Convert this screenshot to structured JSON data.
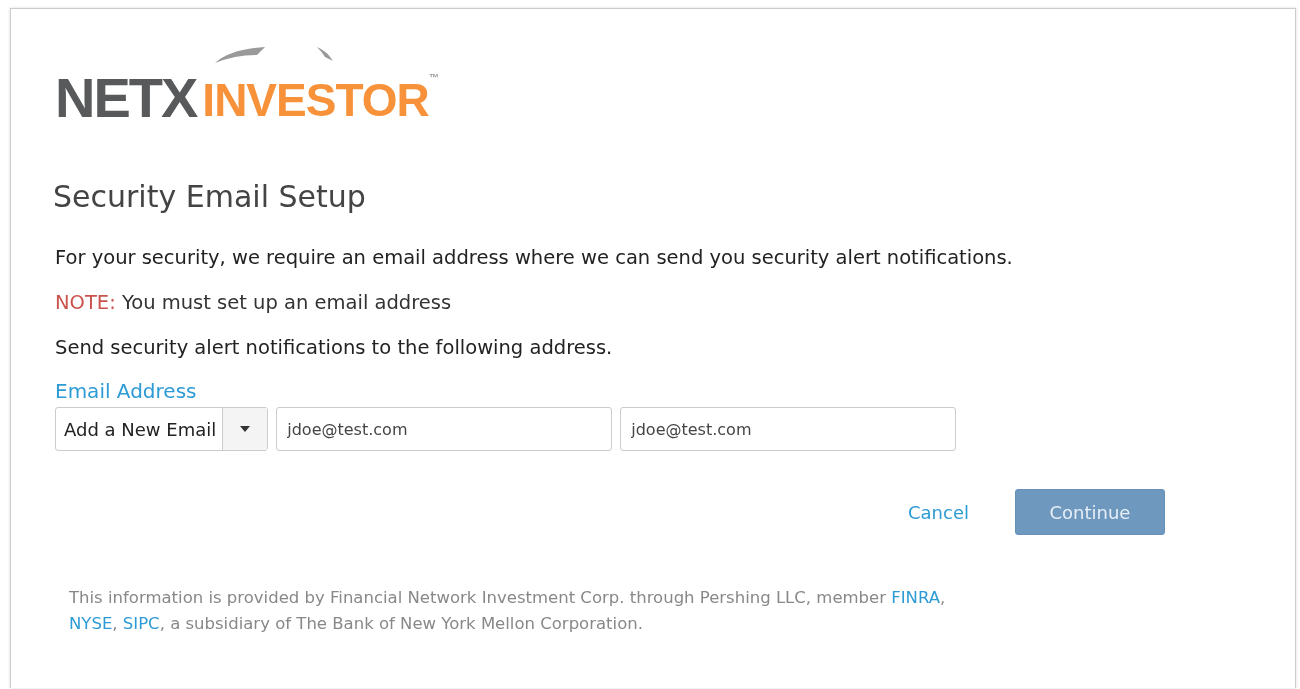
{
  "logo": {
    "part_1": "NETX",
    "part_2": "INVESTOR",
    "trademark": "™"
  },
  "heading": "Security Email Setup",
  "intro": "For your security, we require an email address where we can send you security alert notifications.",
  "note": {
    "label": "NOTE:",
    "text": "You must set up an email address"
  },
  "instruction": "Send security alert notifications to the following address.",
  "email": {
    "label": "Email Address",
    "dropdown": "Add a New Email",
    "fields": [
      {
        "value": "jdoe@test.com"
      },
      {
        "value": "jdoe@test.com"
      }
    ]
  },
  "buttons": [
    {
      "kind": "link",
      "label": "Cancel",
      "disabled": false
    },
    {
      "kind": "primary",
      "label": "Continue",
      "disabled": true
    }
  ],
  "footer": [
    {
      "kind": "text",
      "text": "This information is provided by Financial Network Investment Corp. through Pershing LLC, member "
    },
    {
      "kind": "link",
      "text": "FINRA"
    },
    {
      "kind": "text",
      "text": ", "
    },
    {
      "kind": "link",
      "text": "NYSE"
    },
    {
      "kind": "text",
      "text": ", "
    },
    {
      "kind": "link",
      "text": "SIPC"
    },
    {
      "kind": "text",
      "text": ", a subsidiary of The Bank of New York Mellon Corporation."
    }
  ]
}
